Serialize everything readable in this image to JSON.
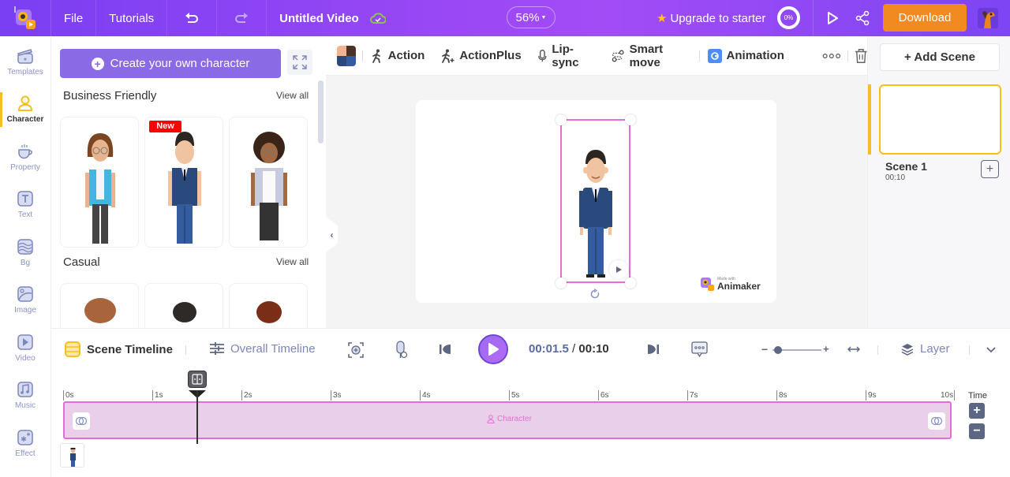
{
  "header": {
    "menu": [
      "File",
      "Tutorials"
    ],
    "title": "Untitled Video",
    "zoom": "56%",
    "upgrade_label": "Upgrade to starter",
    "progress": "0%",
    "download_label": "Download",
    "colors": {
      "brand": "#8b45f4",
      "download": "#f18a21",
      "star": "#ffc21a"
    }
  },
  "sidebar": {
    "items": [
      {
        "label": "Templates",
        "icon": "clapperboard-icon"
      },
      {
        "label": "Character",
        "icon": "user-icon",
        "active": true
      },
      {
        "label": "Property",
        "icon": "cup-icon"
      },
      {
        "label": "Text",
        "icon": "text-icon"
      },
      {
        "label": "Bg",
        "icon": "layers-wave-icon"
      },
      {
        "label": "Image",
        "icon": "image-icon"
      },
      {
        "label": "Video",
        "icon": "video-icon"
      },
      {
        "label": "Music",
        "icon": "music-icon"
      },
      {
        "label": "Effect",
        "icon": "sparkle-icon"
      }
    ]
  },
  "characters": {
    "create_label": "Create your own character",
    "sections": [
      {
        "title": "Business Friendly",
        "view_all": "View all",
        "badge": "New"
      },
      {
        "title": "Casual",
        "view_all": "View all"
      }
    ]
  },
  "toolbar": {
    "items": [
      "Action",
      "ActionPlus",
      "Lip-sync",
      "Smart move",
      "Animation"
    ]
  },
  "stage": {
    "watermark_small": "Made with",
    "watermark_brand": "Animaker"
  },
  "scenes": {
    "add_label": "+ Add Scene",
    "list": [
      {
        "name": "Scene 1",
        "duration": "00:10"
      }
    ]
  },
  "timeline": {
    "scene_tab": "Scene Timeline",
    "overall_tab": "Overall Timeline",
    "current_time": "00:01.5",
    "separator": " / ",
    "total_time": "00:10",
    "layer_label": "Layer",
    "time_label": "Time",
    "ticks": [
      "0s",
      "1s",
      "2s",
      "3s",
      "4s",
      "5s",
      "6s",
      "7s",
      "8s",
      "9s",
      "10s"
    ],
    "track_label": "Character",
    "playhead_seconds": 1.5,
    "zoom_level": 0.12
  }
}
